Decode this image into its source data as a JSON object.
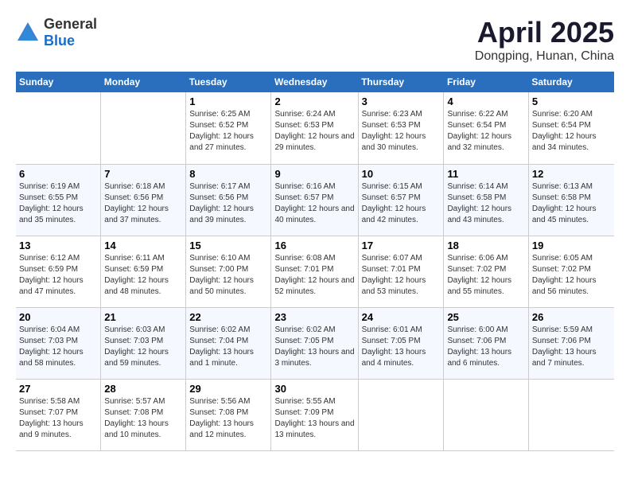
{
  "header": {
    "logo_general": "General",
    "logo_blue": "Blue",
    "month_title": "April 2025",
    "location": "Dongping, Hunan, China"
  },
  "days_of_week": [
    "Sunday",
    "Monday",
    "Tuesday",
    "Wednesday",
    "Thursday",
    "Friday",
    "Saturday"
  ],
  "weeks": [
    [
      {
        "day": "",
        "info": ""
      },
      {
        "day": "",
        "info": ""
      },
      {
        "day": "1",
        "sunrise": "6:25 AM",
        "sunset": "6:52 PM",
        "daylight": "12 hours and 27 minutes."
      },
      {
        "day": "2",
        "sunrise": "6:24 AM",
        "sunset": "6:53 PM",
        "daylight": "12 hours and 29 minutes."
      },
      {
        "day": "3",
        "sunrise": "6:23 AM",
        "sunset": "6:53 PM",
        "daylight": "12 hours and 30 minutes."
      },
      {
        "day": "4",
        "sunrise": "6:22 AM",
        "sunset": "6:54 PM",
        "daylight": "12 hours and 32 minutes."
      },
      {
        "day": "5",
        "sunrise": "6:20 AM",
        "sunset": "6:54 PM",
        "daylight": "12 hours and 34 minutes."
      }
    ],
    [
      {
        "day": "6",
        "sunrise": "6:19 AM",
        "sunset": "6:55 PM",
        "daylight": "12 hours and 35 minutes."
      },
      {
        "day": "7",
        "sunrise": "6:18 AM",
        "sunset": "6:56 PM",
        "daylight": "12 hours and 37 minutes."
      },
      {
        "day": "8",
        "sunrise": "6:17 AM",
        "sunset": "6:56 PM",
        "daylight": "12 hours and 39 minutes."
      },
      {
        "day": "9",
        "sunrise": "6:16 AM",
        "sunset": "6:57 PM",
        "daylight": "12 hours and 40 minutes."
      },
      {
        "day": "10",
        "sunrise": "6:15 AM",
        "sunset": "6:57 PM",
        "daylight": "12 hours and 42 minutes."
      },
      {
        "day": "11",
        "sunrise": "6:14 AM",
        "sunset": "6:58 PM",
        "daylight": "12 hours and 43 minutes."
      },
      {
        "day": "12",
        "sunrise": "6:13 AM",
        "sunset": "6:58 PM",
        "daylight": "12 hours and 45 minutes."
      }
    ],
    [
      {
        "day": "13",
        "sunrise": "6:12 AM",
        "sunset": "6:59 PM",
        "daylight": "12 hours and 47 minutes."
      },
      {
        "day": "14",
        "sunrise": "6:11 AM",
        "sunset": "6:59 PM",
        "daylight": "12 hours and 48 minutes."
      },
      {
        "day": "15",
        "sunrise": "6:10 AM",
        "sunset": "7:00 PM",
        "daylight": "12 hours and 50 minutes."
      },
      {
        "day": "16",
        "sunrise": "6:08 AM",
        "sunset": "7:01 PM",
        "daylight": "12 hours and 52 minutes."
      },
      {
        "day": "17",
        "sunrise": "6:07 AM",
        "sunset": "7:01 PM",
        "daylight": "12 hours and 53 minutes."
      },
      {
        "day": "18",
        "sunrise": "6:06 AM",
        "sunset": "7:02 PM",
        "daylight": "12 hours and 55 minutes."
      },
      {
        "day": "19",
        "sunrise": "6:05 AM",
        "sunset": "7:02 PM",
        "daylight": "12 hours and 56 minutes."
      }
    ],
    [
      {
        "day": "20",
        "sunrise": "6:04 AM",
        "sunset": "7:03 PM",
        "daylight": "12 hours and 58 minutes."
      },
      {
        "day": "21",
        "sunrise": "6:03 AM",
        "sunset": "7:03 PM",
        "daylight": "12 hours and 59 minutes."
      },
      {
        "day": "22",
        "sunrise": "6:02 AM",
        "sunset": "7:04 PM",
        "daylight": "13 hours and 1 minute."
      },
      {
        "day": "23",
        "sunrise": "6:02 AM",
        "sunset": "7:05 PM",
        "daylight": "13 hours and 3 minutes."
      },
      {
        "day": "24",
        "sunrise": "6:01 AM",
        "sunset": "7:05 PM",
        "daylight": "13 hours and 4 minutes."
      },
      {
        "day": "25",
        "sunrise": "6:00 AM",
        "sunset": "7:06 PM",
        "daylight": "13 hours and 6 minutes."
      },
      {
        "day": "26",
        "sunrise": "5:59 AM",
        "sunset": "7:06 PM",
        "daylight": "13 hours and 7 minutes."
      }
    ],
    [
      {
        "day": "27",
        "sunrise": "5:58 AM",
        "sunset": "7:07 PM",
        "daylight": "13 hours and 9 minutes."
      },
      {
        "day": "28",
        "sunrise": "5:57 AM",
        "sunset": "7:08 PM",
        "daylight": "13 hours and 10 minutes."
      },
      {
        "day": "29",
        "sunrise": "5:56 AM",
        "sunset": "7:08 PM",
        "daylight": "13 hours and 12 minutes."
      },
      {
        "day": "30",
        "sunrise": "5:55 AM",
        "sunset": "7:09 PM",
        "daylight": "13 hours and 13 minutes."
      },
      {
        "day": "",
        "info": ""
      },
      {
        "day": "",
        "info": ""
      },
      {
        "day": "",
        "info": ""
      }
    ]
  ]
}
